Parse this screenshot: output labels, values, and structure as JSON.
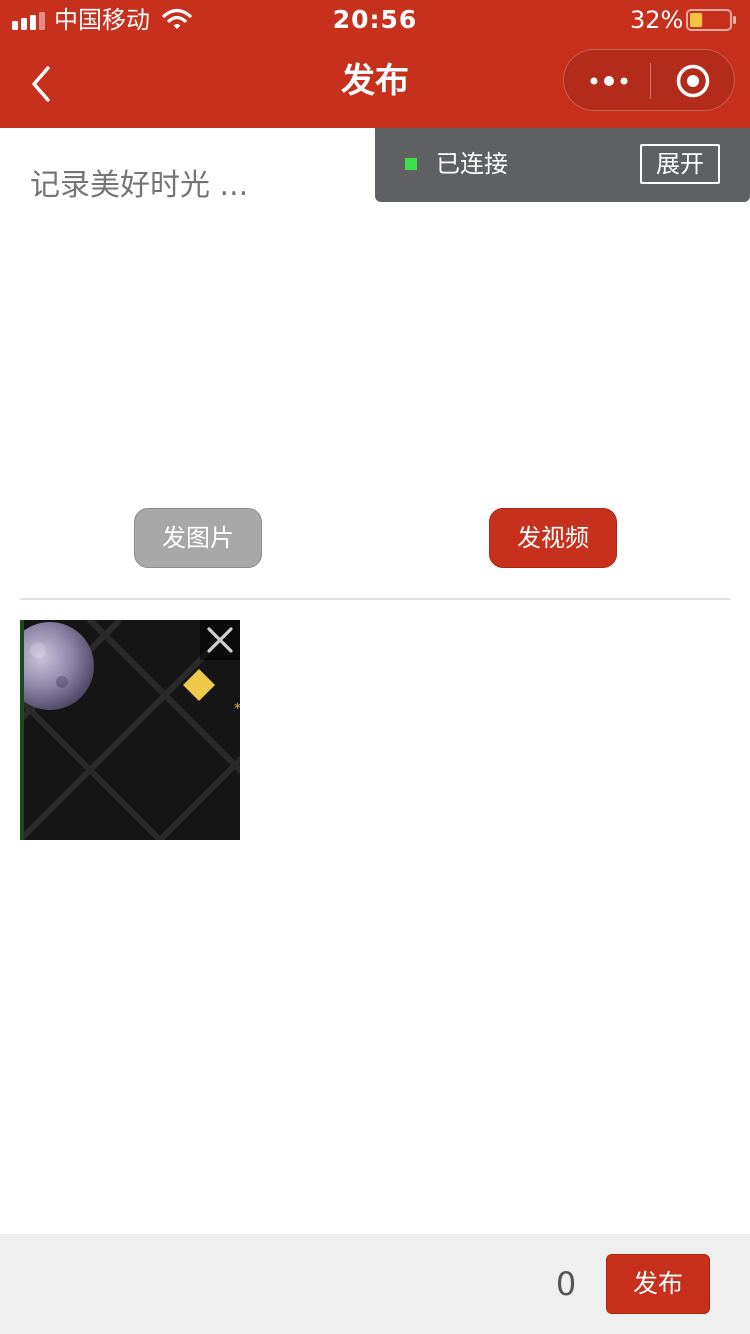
{
  "status_bar": {
    "carrier": "中国移动",
    "time": "20:56",
    "battery_percent": "32%",
    "battery_level": 0.32
  },
  "nav": {
    "title": "发布",
    "back_icon": "chevron-left-icon",
    "more_icon": "more-dots-icon",
    "close_icon": "target-circle-icon"
  },
  "connection": {
    "status": "已连接",
    "expand_label": "展开",
    "status_color": "#3ce04a"
  },
  "editor": {
    "placeholder": "记录美好时光 ..."
  },
  "media_buttons": {
    "image_label": "发图片",
    "video_label": "发视频"
  },
  "thumbnail": {
    "remove_icon": "close-icon"
  },
  "footer": {
    "count": "0",
    "publish_label": "发布"
  },
  "colors": {
    "brand": "#c8301e",
    "popup_bg": "#5f6064",
    "disabled_button": "#a8a8a8",
    "footer_bg": "#efefef"
  }
}
